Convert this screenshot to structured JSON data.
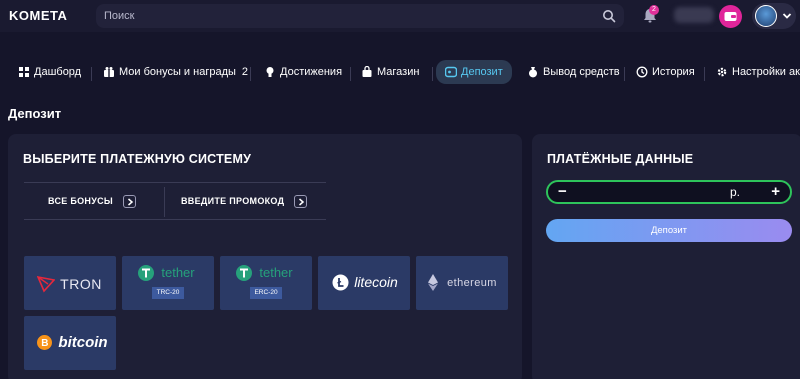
{
  "header": {
    "logo": "KOMETA",
    "search_placeholder": "Поиск",
    "notifications_count": "2"
  },
  "nav": {
    "items": [
      {
        "label": "Дашборд",
        "icon": "dashboard-icon"
      },
      {
        "label": "Мои бонусы и награды",
        "count": "2",
        "icon": "gift-icon"
      },
      {
        "label": "Достижения",
        "icon": "achievement-icon"
      },
      {
        "label": "Магазин",
        "icon": "shop-icon"
      },
      {
        "label": "Депозит",
        "icon": "wallet-icon",
        "active": true
      },
      {
        "label": "Вывод средств",
        "icon": "money-bag-icon"
      },
      {
        "label": "История",
        "icon": "clock-icon"
      },
      {
        "label": "Настройки ак",
        "icon": "gear-icon"
      }
    ]
  },
  "page": {
    "title": "Депозит"
  },
  "payment": {
    "heading": "ВЫБЕРИТЕ ПЛАТЕЖНУЮ СИСТЕМУ",
    "tab_bonuses": "ВСЕ БОНУСЫ",
    "tab_promo": "ВВЕДИТЕ ПРОМОКОД",
    "methods": [
      {
        "name": "TRON"
      },
      {
        "name": "tether",
        "network": "TRC-20"
      },
      {
        "name": "tether",
        "network": "ERC-20"
      },
      {
        "name": "litecoin"
      },
      {
        "name": "ethereum"
      },
      {
        "name": "bitcoin"
      }
    ]
  },
  "details": {
    "heading": "ПЛАТЁЖНЫЕ ДАННЫЕ",
    "minus": "−",
    "plus": "+",
    "currency": "р.",
    "deposit_button": "Депозит"
  },
  "colors": {
    "background": "#15152a",
    "panel": "#1e1f36",
    "accent_blue": "#57c8f0",
    "amount_border": "#2ec45b",
    "wallet_pink": "#e0259a",
    "tron_red": "#e5283c",
    "tether_green": "#26a17b",
    "bitcoin_orange": "#f7931a"
  }
}
